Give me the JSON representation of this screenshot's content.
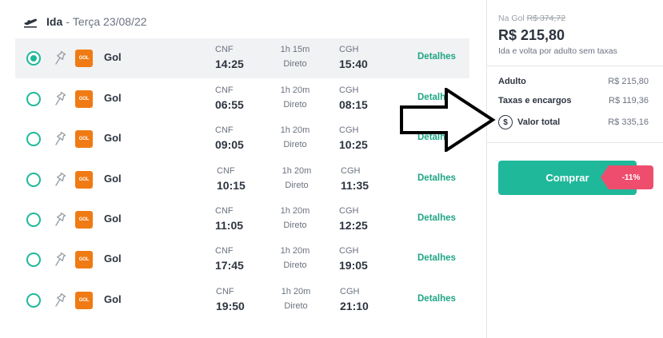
{
  "header": {
    "icon": "plane-departure-icon",
    "direction": "Ida",
    "separator": "-",
    "date": "Terça 23/08/22"
  },
  "flights": [
    {
      "selected": true,
      "airline": "Gol",
      "logo": "GOL",
      "from": "CNF",
      "dep": "14:25",
      "duration": "1h 15m",
      "stops": "Direto",
      "to": "CGH",
      "arr": "15:40",
      "details": "Detalhes"
    },
    {
      "selected": false,
      "airline": "Gol",
      "logo": "GOL",
      "from": "CNF",
      "dep": "06:55",
      "duration": "1h 20m",
      "stops": "Direto",
      "to": "CGH",
      "arr": "08:15",
      "details": "Detalhes"
    },
    {
      "selected": false,
      "airline": "Gol",
      "logo": "GOL",
      "from": "CNF",
      "dep": "09:05",
      "duration": "1h 20m",
      "stops": "Direto",
      "to": "CGH",
      "arr": "10:25",
      "details": "Detalhes"
    },
    {
      "selected": false,
      "airline": "Gol",
      "logo": "GOL",
      "from": "CNF",
      "dep": "10:15",
      "duration": "1h 20m",
      "stops": "Direto",
      "to": "CGH",
      "arr": "11:35",
      "details": "Detalhes"
    },
    {
      "selected": false,
      "airline": "Gol",
      "logo": "GOL",
      "from": "CNF",
      "dep": "11:05",
      "duration": "1h 20m",
      "stops": "Direto",
      "to": "CGH",
      "arr": "12:25",
      "details": "Detalhes"
    },
    {
      "selected": false,
      "airline": "Gol",
      "logo": "GOL",
      "from": "CNF",
      "dep": "17:45",
      "duration": "1h 20m",
      "stops": "Direto",
      "to": "CGH",
      "arr": "19:05",
      "details": "Detalhes"
    },
    {
      "selected": false,
      "airline": "Gol",
      "logo": "GOL",
      "from": "CNF",
      "dep": "19:50",
      "duration": "1h 20m",
      "stops": "Direto",
      "to": "CGH",
      "arr": "21:10",
      "details": "Detalhes"
    }
  ],
  "summary": {
    "old_prefix": "Na Gol",
    "old_price": "R$ 374,72",
    "price": "R$ 215,80",
    "price_note": "Ida e volta por adulto sem taxas",
    "adult_label": "Adulto",
    "adult_value": "R$ 215,80",
    "taxes_label": "Taxas e encargos",
    "taxes_value": "R$ 119,36",
    "total_icon": "dollar-circle-icon",
    "total_symbol": "$",
    "total_label": "Valor total",
    "total_value": "R$ 335,16",
    "buy_label": "Comprar",
    "discount": "-11%"
  },
  "colors": {
    "accent": "#1fb89a",
    "link": "#1fa586",
    "discount": "#ef4d6d",
    "gol_orange": "#f07b14"
  }
}
